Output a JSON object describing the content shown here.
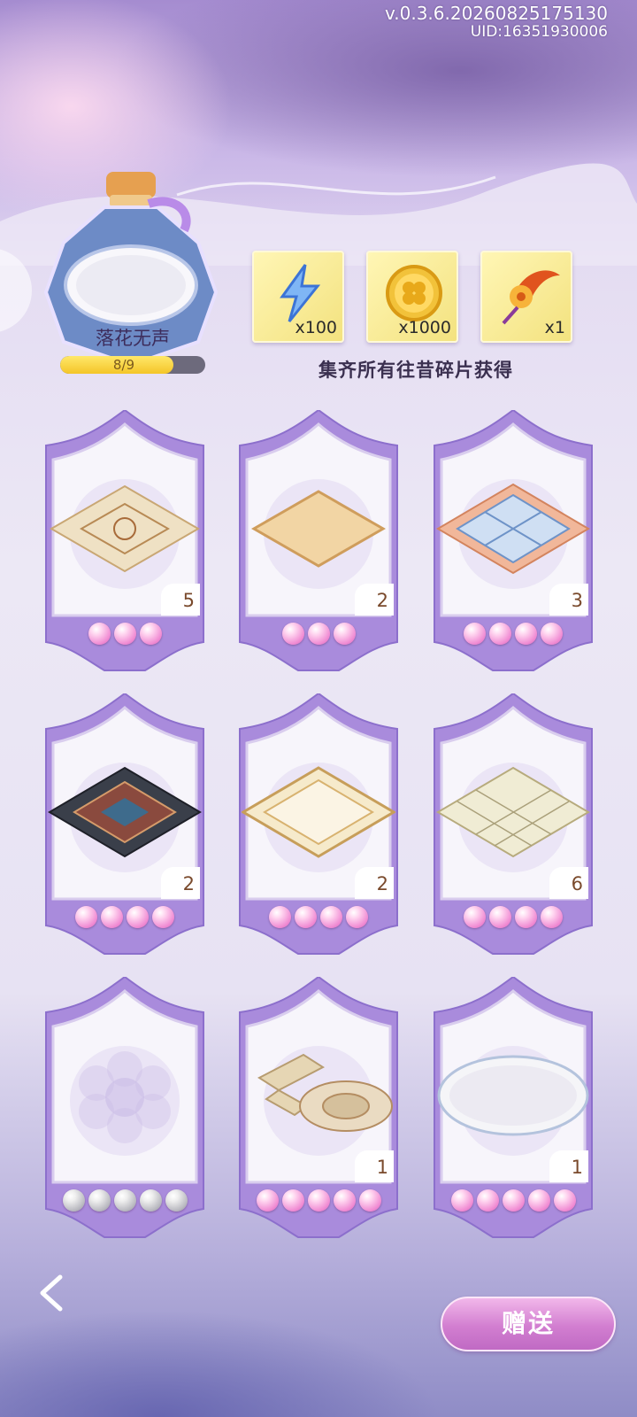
{
  "header": {
    "version": "v.0.3.6.20260825175130",
    "uid": "UID:16351930006"
  },
  "collection": {
    "name": "落花无声",
    "progress_text": "8/9",
    "progress_fraction": 0.889
  },
  "rewards": [
    {
      "icon": "lightning-energy-icon",
      "qty": "x100"
    },
    {
      "icon": "clover-gold-coin-icon",
      "qty": "x1000"
    },
    {
      "icon": "flower-hair-ornament-icon",
      "qty": "x1"
    }
  ],
  "reward_caption": "集齐所有往昔碎片获得",
  "fragments": [
    {
      "icon": "beige-medallion-rug-icon",
      "count": "5",
      "pearls": 3,
      "pearl_color": "pink"
    },
    {
      "icon": "plain-tan-rug-icon",
      "count": "2",
      "pearls": 3,
      "pearl_color": "pink"
    },
    {
      "icon": "blue-tile-rug-icon",
      "count": "3",
      "pearls": 4,
      "pearl_color": "pink"
    },
    {
      "icon": "persian-dark-rug-icon",
      "count": "2",
      "pearls": 4,
      "pearl_color": "pink"
    },
    {
      "icon": "cream-ornate-rug-icon",
      "count": "2",
      "pearls": 4,
      "pearl_color": "pink"
    },
    {
      "icon": "lattice-rug-icon",
      "count": "6",
      "pearls": 4,
      "pearl_color": "pink"
    },
    {
      "icon": "empty-flower-slot-icon",
      "count": "",
      "pearls": 5,
      "pearl_color": "grey"
    },
    {
      "icon": "stone-path-rug-icon",
      "count": "1",
      "pearls": 5,
      "pearl_color": "pink"
    },
    {
      "icon": "round-petal-rug-icon",
      "count": "1",
      "pearls": 5,
      "pearl_color": "pink"
    }
  ],
  "buttons": {
    "back_icon": "chevron-left-icon",
    "gift_label": "赠送"
  },
  "colors": {
    "card_purple": "#a98bdc",
    "pearl_pink": "#f08bd3",
    "gift_button": "#d27ed0"
  }
}
